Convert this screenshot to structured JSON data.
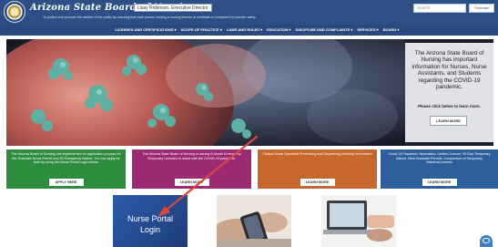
{
  "header": {
    "site_title": "Arizona State Board of Nursing",
    "director_label": "Lisay Robinson, Executive Director",
    "tagline": "To protect and promote the welfare of the public by ensuring that each person holding a nursing license or certificate is competent to practice safely.",
    "search_placeholder": "Search",
    "translate_label": "Translate"
  },
  "nav": {
    "items": [
      {
        "label": "LICENSES AND CERTIFICATIONS ▾"
      },
      {
        "label": "SCOPE OF PRACTICE ▾"
      },
      {
        "label": "LAWS AND RULES ▾"
      },
      {
        "label": "EDUCATION ▾"
      },
      {
        "label": "DISCIPLINE AND COMPLAINTS ▾"
      },
      {
        "label": "SERVICES ▾"
      },
      {
        "label": "BOARD ▾"
      }
    ]
  },
  "hero": {
    "text": "The Arizona State Board of Nursing has important information for Nurses, Nurse Assistants, and Students regarding the COVID-19 pandemic.",
    "sub_text": "Please click below to learn more.",
    "button_label": "LEARN MORE"
  },
  "cards": [
    {
      "text": "The Arizona Board of Nursing has implemented an application process for the Graduate Nurse Permit and 90 Emergency Waiver. You can apply for both by using the Nurse Portal Login below.",
      "button_label": "APPLY HERE",
      "color": "#2e8c3f"
    },
    {
      "text": "The Arizona State Board of Nursing is issuing 6-Month Emergency Temporary Licenses to assist with the COVID-19 pandemic.",
      "button_label": "LEARN MORE",
      "color": "#9b2a72"
    },
    {
      "text": "Clinical Nurse Specialist Prescribing and Dispensing Authority Information",
      "button_label": "LEARN MORE",
      "color": "#c8672d"
    },
    {
      "text": "Covid-19 Pandemic Vaccination, Limited License, 90-Day Temporary Waiver, New Graduate Permits, Comparison of Temporary Waivers/Licenses",
      "button_label": "LEARN MORE",
      "color": "#2e5e9c"
    }
  ],
  "tiles": {
    "portal_line1": "Nurse Portal",
    "portal_line2": "Login"
  },
  "icons": {
    "seal": "board-seal-icon",
    "chat": "chat-bubble-icon",
    "arrow": "annotation-arrow-icon"
  },
  "colors": {
    "header_bg": "#2c4f86",
    "nav_bg": "#2a4a7f",
    "arrow": "#d9473f"
  }
}
